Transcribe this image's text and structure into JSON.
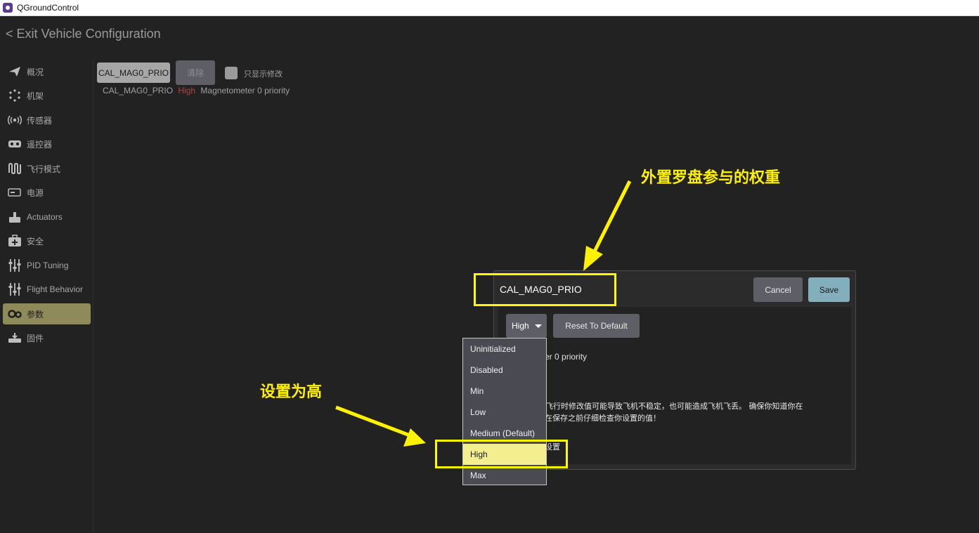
{
  "window": {
    "title": "QGroundControl"
  },
  "exit_label": "< Exit Vehicle Configuration",
  "sidebar": {
    "items": [
      {
        "label": "概况",
        "icon": "paper-plane-icon"
      },
      {
        "label": "机架",
        "icon": "frame-dots-icon"
      },
      {
        "label": "传感器",
        "icon": "sensor-icon"
      },
      {
        "label": "遥控器",
        "icon": "radio-icon"
      },
      {
        "label": "飞行模式",
        "icon": "flight-modes-icon"
      },
      {
        "label": "电源",
        "icon": "battery-icon"
      },
      {
        "label": "Actuators",
        "icon": "actuators-icon"
      },
      {
        "label": "安全",
        "icon": "safety-icon"
      },
      {
        "label": "PID Tuning",
        "icon": "sliders-icon"
      },
      {
        "label": "Flight Behavior",
        "icon": "sliders-icon"
      },
      {
        "label": "参数",
        "icon": "gears-icon",
        "active": true
      },
      {
        "label": "固件",
        "icon": "firmware-icon"
      }
    ]
  },
  "search": {
    "value": "CAL_MAG0_PRIO"
  },
  "clear_label": "清除",
  "show_modified_label": "只显示修改",
  "param_row": {
    "name": "CAL_MAG0_PRIO",
    "value": "High",
    "description": "Magnetometer 0 priority"
  },
  "dialog": {
    "title": "CAL_MAG0_PRIO",
    "cancel_label": "Cancel",
    "save_label": "Save",
    "value": "High",
    "reset_label": "Reset To Default",
    "description_visible": "eter 0 priority",
    "warning_line1": "机飞行时修改值可能导致飞机不稳定，也可能造成飞机飞丢。 确保你知道你在",
    "warning_line2": "在保存之前仔细检查你设置的值！",
    "advanced_visible": "设置"
  },
  "dropdown": {
    "options": [
      "Uninitialized",
      "Disabled",
      "Min",
      "Low",
      "Medium (Default)",
      "High",
      "Max"
    ],
    "selected": "High"
  },
  "annotations": {
    "top": "外置罗盘参与的权重",
    "left": "设置为高",
    "color": "#fff200"
  }
}
